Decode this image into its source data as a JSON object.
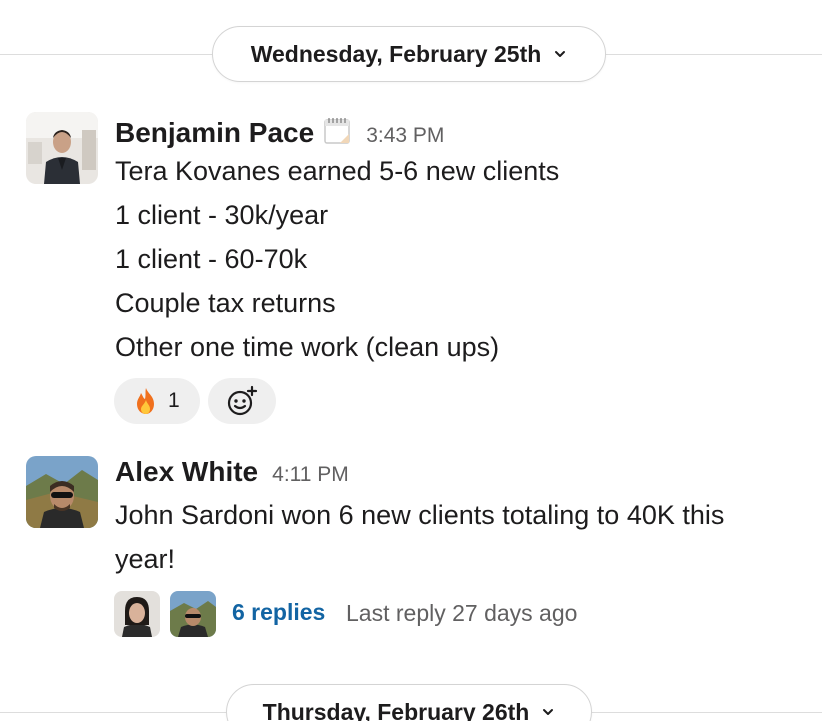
{
  "dividers": [
    {
      "label": "Wednesday, February 25th"
    },
    {
      "label": "Thursday, February 26th"
    }
  ],
  "messages": [
    {
      "author": "Benjamin Pace",
      "status_emoji": "calendar-icon",
      "time": "3:43 PM",
      "lines": [
        "Tera Kovanes earned 5-6 new clients",
        "1 client - 30k/year",
        "1 client - 60-70k",
        "Couple tax returns",
        "Other one time work (clean ups)"
      ],
      "reactions": [
        {
          "emoji": "fire-icon",
          "count": "1"
        }
      ],
      "add_reaction_icon": "add-reaction-icon"
    },
    {
      "author": "Alex White",
      "time": "4:11 PM",
      "lines": [
        "John Sardoni won 6 new clients totaling to 40K this",
        "year!"
      ],
      "thread": {
        "replies": "6 replies",
        "last_reply": "Last reply 27 days ago"
      }
    }
  ],
  "colors": {
    "link": "#1264a3",
    "muted": "#616061",
    "reaction_bg": "#efefef",
    "divider": "#dddddd"
  }
}
